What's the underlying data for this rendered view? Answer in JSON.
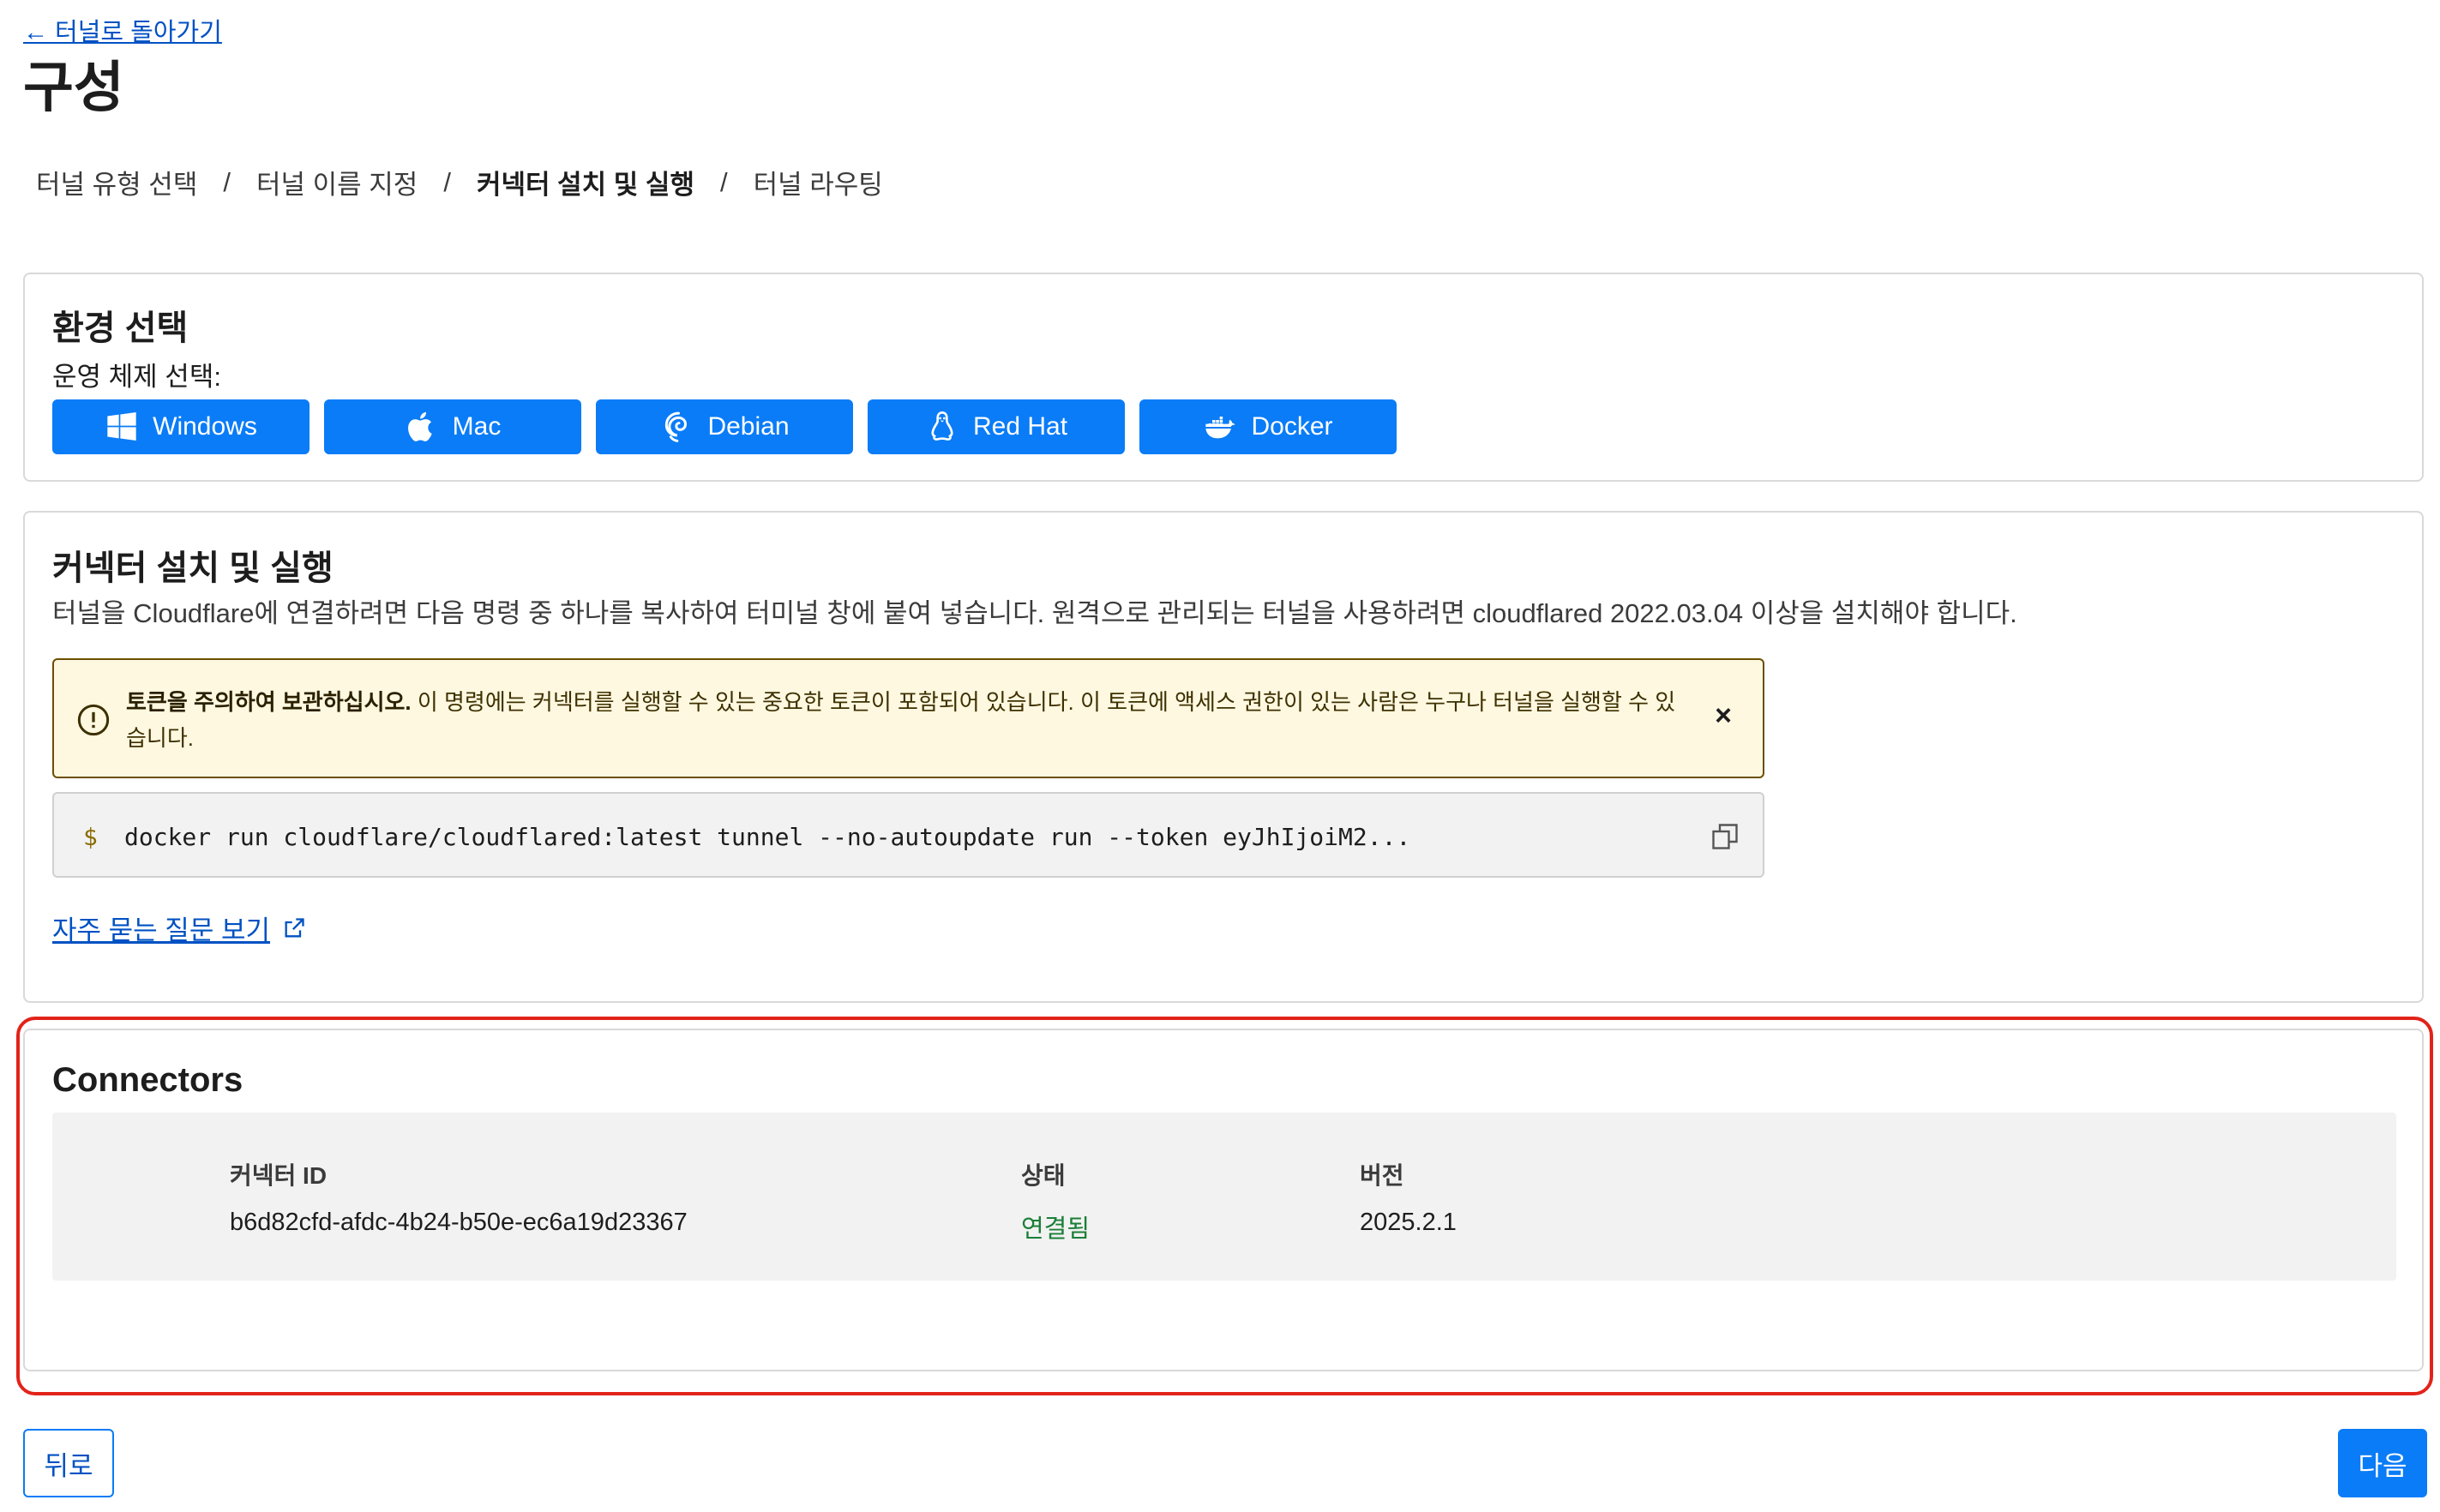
{
  "back_link": "← 터널로 돌아가기",
  "title": "구성",
  "breadcrumb": [
    "터널 유형 선택",
    "터널 이름 지정",
    "커넥터 설치 및 실행",
    "터널 라우팅"
  ],
  "breadcrumb_separator": "/",
  "environment": {
    "heading": "환경 선택",
    "os_label": "운영 체제 선택:",
    "buttons": [
      {
        "label": "Windows",
        "icon": "windows-icon"
      },
      {
        "label": "Mac",
        "icon": "apple-icon"
      },
      {
        "label": "Debian",
        "icon": "debian-icon"
      },
      {
        "label": "Red Hat",
        "icon": "linux-icon"
      },
      {
        "label": "Docker",
        "icon": "docker-icon"
      }
    ]
  },
  "install": {
    "heading": "커넥터 설치 및 실행",
    "description": "터널을 Cloudflare에 연결하려면 다음 명령 중 하나를 복사하여 터미널 창에 붙여 넣습니다. 원격으로 관리되는 터널을 사용하려면 cloudflared 2022.03.04 이상을 설치해야 합니다.",
    "warning_bold": "토큰을 주의하여 보관하십시오.",
    "warning_text": " 이 명령에는 커넥터를 실행할 수 있는 중요한 토큰이 포함되어 있습니다. 이 토큰에 액세스 권한이 있는 사람은 누구나 터널을 실행할 수 있습니다.",
    "warning_close": "×",
    "prompt": "$",
    "command": "docker run cloudflare/cloudflared:latest tunnel --no-autoupdate run --token eyJhIjoiM2...",
    "faq_link": "자주 묻는 질문 보기"
  },
  "connectors": {
    "heading": "Connectors",
    "columns": [
      "커넥터 ID",
      "상태",
      "버전"
    ],
    "rows": [
      {
        "id": "b6d82cfd-afdc-4b24-b50e-ec6a19d23367",
        "status": "연결됨",
        "version": "2025.2.1"
      }
    ]
  },
  "footer": {
    "back": "뒤로",
    "next": "다음"
  },
  "colors": {
    "accent": "#0a7cf7",
    "link": "#0051c3",
    "status_ok": "#1a7f37",
    "warning_bg": "#fff8e1",
    "highlight": "#e2231a"
  }
}
